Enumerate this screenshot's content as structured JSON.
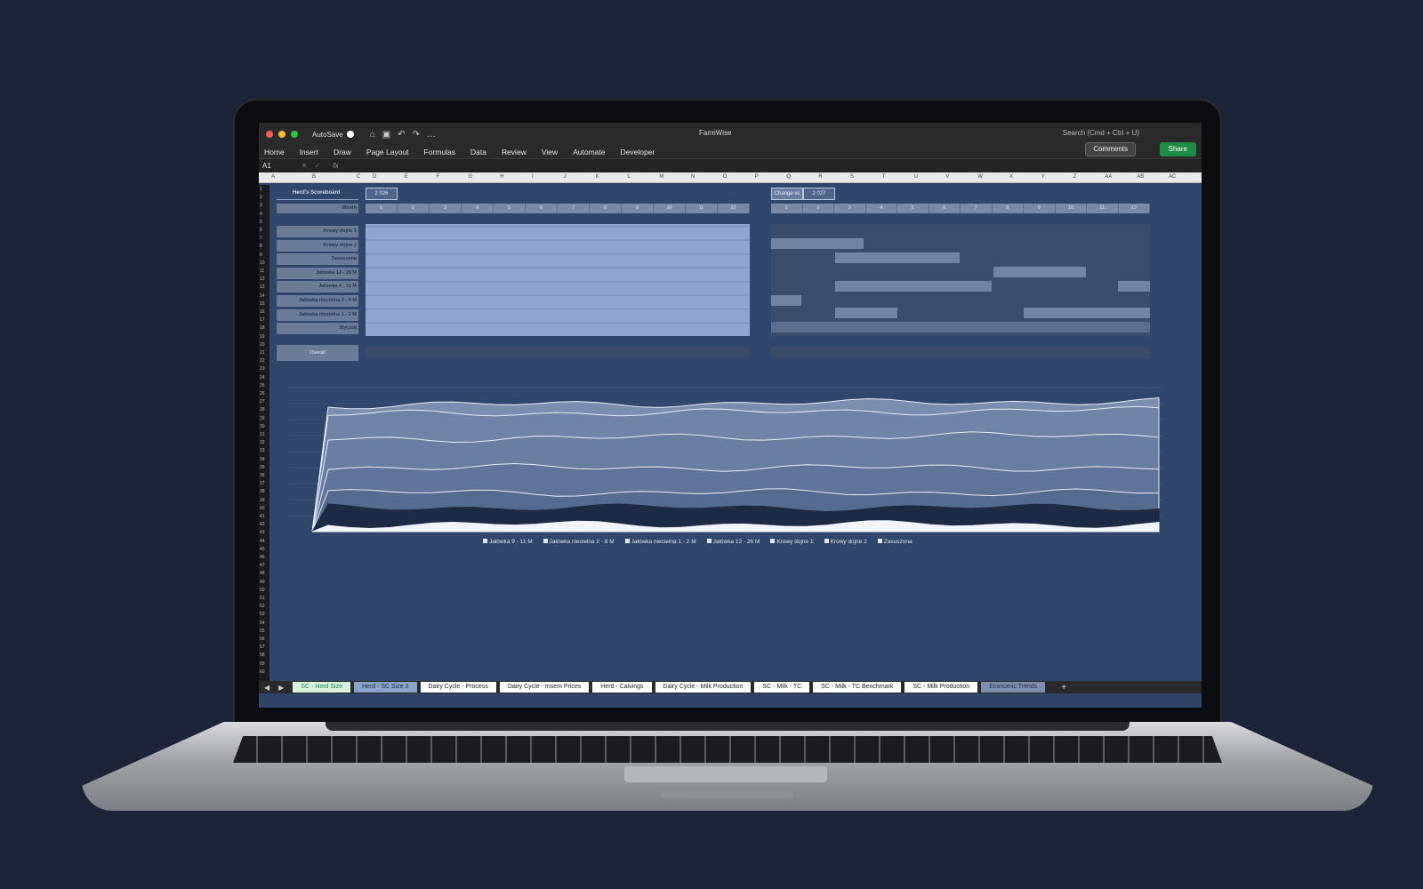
{
  "window": {
    "autosave_label": "AutoSave",
    "doc_title": "FarmWise",
    "search_placeholder": "Search (Cmd + Ctrl + U)"
  },
  "ribbon": {
    "tabs": [
      "Home",
      "Insert",
      "Draw",
      "Page Layout",
      "Formulas",
      "Data",
      "Review",
      "View",
      "Automate",
      "Developer"
    ],
    "comments_label": "Comments",
    "share_label": "Share"
  },
  "formula_bar": {
    "cell_ref": "A1",
    "fx": "fx"
  },
  "columns": [
    "A",
    "B",
    "C",
    "D",
    "E",
    "F",
    "G",
    "H",
    "I",
    "J",
    "K",
    "L",
    "M",
    "N",
    "O",
    "P",
    "Q",
    "R",
    "S",
    "T",
    "U",
    "V",
    "W",
    "X",
    "Y",
    "Z",
    "AA",
    "AB",
    "AC"
  ],
  "scoreboard": {
    "title": "Herd's Scoreboard",
    "year": "2 026",
    "month_label": "Month",
    "months": [
      "1",
      "2",
      "3",
      "4",
      "5",
      "6",
      "7",
      "8",
      "9",
      "10",
      "11",
      "12"
    ],
    "change_label": "Change vs",
    "change_year": "2 027",
    "rows": [
      "Krowy dojne 1",
      "Krowy dojne 2",
      "Zasuszona",
      "Jałówka 12 - 26 M",
      "Jałówka 9 - 11 M",
      "Jałówka niecielna 2 - 8 M",
      "Jałówka niecielna 1 - 2 M",
      "Byczek"
    ],
    "overall_label": "Overall"
  },
  "chart_data": {
    "type": "area",
    "series": [
      {
        "name": "Jałówka 9 - 11 M"
      },
      {
        "name": "Jałówka niecielna 2 - 8 M"
      },
      {
        "name": "Jałówka niecielna 1 - 2 M"
      },
      {
        "name": "Jałówka 12 - 26 M"
      },
      {
        "name": "Krowy dojne 1"
      },
      {
        "name": "Krowy dojne 2"
      },
      {
        "name": "Zasuszona"
      }
    ]
  },
  "sheet_tabs": [
    "SC - Herd Size",
    "Herd - SC Size 2",
    "Dairy Cycle - Process",
    "Dairy Cycle - Insem Prices",
    "Herd - Calvings",
    "Dairy Cycle - Milk Production",
    "SC - Milk - TC",
    "SC - Milk - TC Benchmark",
    "SC - Milk Production",
    "Economic Trends"
  ]
}
